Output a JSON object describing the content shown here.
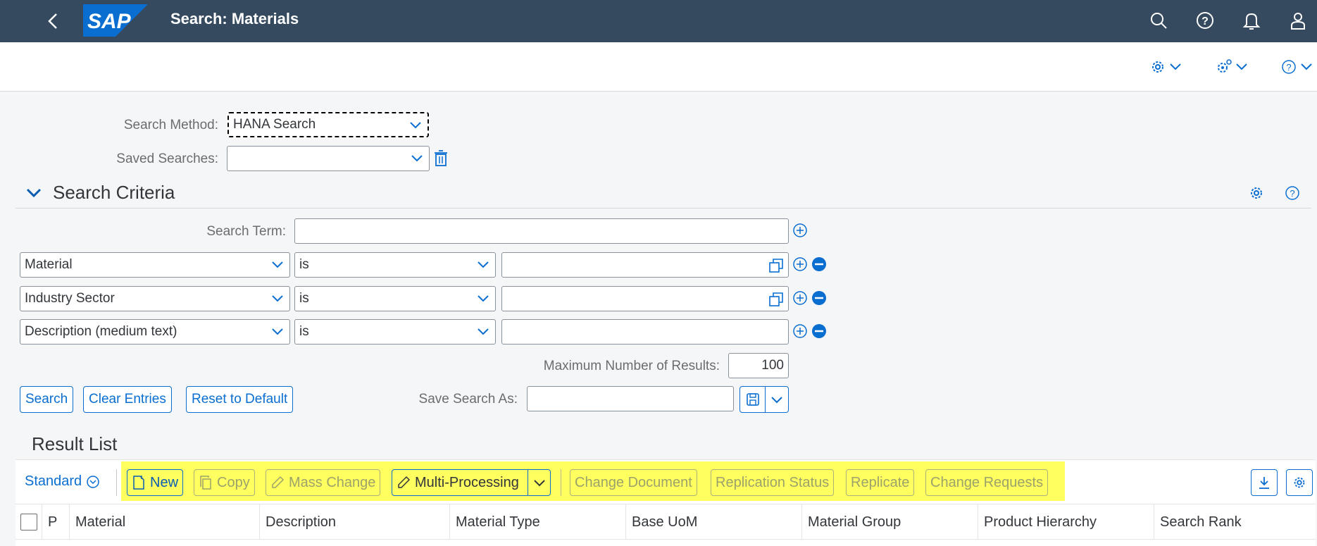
{
  "shell": {
    "title": "Search: Materials",
    "logo_text": "SAP",
    "icons": [
      "search-icon",
      "help-icon",
      "notifications-icon",
      "user-icon"
    ]
  },
  "subbar": {
    "icons": [
      "settings-icon",
      "system-settings-icon",
      "help-icon"
    ]
  },
  "search_method": {
    "label": "Search Method:",
    "value": "HANA Search"
  },
  "saved_searches": {
    "label": "Saved Searches:",
    "value": ""
  },
  "criteria": {
    "title": "Search Criteria",
    "search_term_label": "Search Term:",
    "search_term_value": "",
    "rows": [
      {
        "field": "Material",
        "operator": "is",
        "value": ""
      },
      {
        "field": "Industry Sector",
        "operator": "is",
        "value": ""
      },
      {
        "field": "Description (medium text)",
        "operator": "is",
        "value": ""
      }
    ],
    "max_results_label": "Maximum Number of Results:",
    "max_results_value": "100",
    "buttons": {
      "search": "Search",
      "clear": "Clear Entries",
      "reset": "Reset to Default"
    },
    "save_search_label": "Save Search As:",
    "save_search_value": ""
  },
  "results": {
    "title": "Result List",
    "variant": "Standard",
    "toolbar": {
      "new": "New",
      "copy": "Copy",
      "mass_change": "Mass Change",
      "multi_processing": "Multi-Processing",
      "change_document": "Change Document",
      "replication_status": "Replication Status",
      "replicate": "Replicate",
      "change_requests": "Change Requests"
    },
    "columns": [
      "P",
      "Material",
      "Description",
      "Material Type",
      "Base UoM",
      "Material Group",
      "Product Hierarchy",
      "Search Rank"
    ]
  },
  "colors": {
    "shell": "#354a5f",
    "accent": "#0a6ed1",
    "highlight": "#ffff33"
  }
}
